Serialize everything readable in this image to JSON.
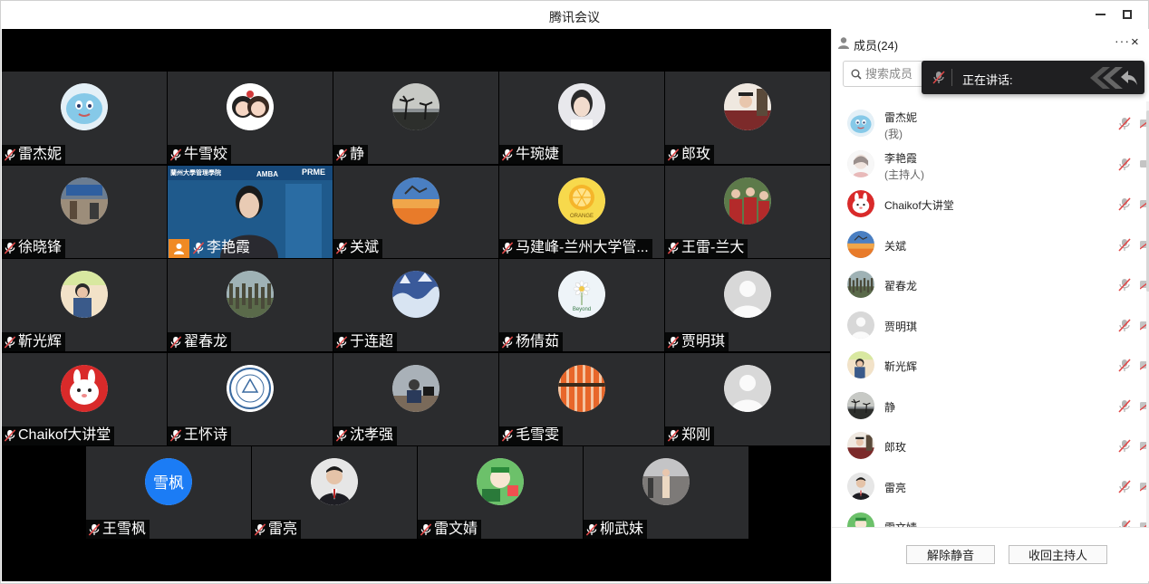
{
  "window": {
    "title": "腾讯会议"
  },
  "tiles": [
    {
      "name": "雷杰妮",
      "avatar": "squirtle",
      "col": 0,
      "row": 0
    },
    {
      "name": "牛雪姣",
      "avatar": "cartoon-couple",
      "col": 1,
      "row": 0
    },
    {
      "name": "静",
      "avatar": "palm-sunset",
      "col": 2,
      "row": 0
    },
    {
      "name": "牛琬婕",
      "avatar": "portrait",
      "col": 3,
      "row": 0
    },
    {
      "name": "郎玫",
      "avatar": "graduation",
      "col": 4,
      "row": 0
    },
    {
      "name": "徐晓锋",
      "avatar": "street",
      "col": 0,
      "row": 1
    },
    {
      "name": "李艳霞",
      "avatar": "video",
      "col": 1,
      "row": 1,
      "video": true,
      "video_text": [
        "蘭州大學管理學院",
        "AMBA",
        "PRME"
      ]
    },
    {
      "name": "关斌",
      "avatar": "sunset-sky",
      "col": 2,
      "row": 1
    },
    {
      "name": "马建峰-兰州大学管...",
      "avatar": "orange",
      "col": 3,
      "row": 1,
      "avatar_text": "ORANGE"
    },
    {
      "name": "王雷-兰大",
      "avatar": "graduation-red",
      "col": 4,
      "row": 1
    },
    {
      "name": "靳光辉",
      "avatar": "child",
      "col": 0,
      "row": 2
    },
    {
      "name": "翟春龙",
      "avatar": "forest",
      "col": 1,
      "row": 2
    },
    {
      "name": "于连超",
      "avatar": "snow",
      "col": 2,
      "row": 2
    },
    {
      "name": "杨倩茹",
      "avatar": "flower",
      "col": 3,
      "row": 2,
      "avatar_text": "Beyond"
    },
    {
      "name": "贾明琪",
      "avatar": "default",
      "col": 4,
      "row": 2
    },
    {
      "name": "Chaikof大讲堂",
      "avatar": "white-rabbit",
      "col": 0,
      "row": 3
    },
    {
      "name": "王怀诗",
      "avatar": "university-seal",
      "col": 1,
      "row": 3
    },
    {
      "name": "沈孝强",
      "avatar": "desk",
      "col": 2,
      "row": 3
    },
    {
      "name": "毛雪雯",
      "avatar": "orange-pattern",
      "col": 3,
      "row": 3
    },
    {
      "name": "郑刚",
      "avatar": "default",
      "col": 4,
      "row": 3
    },
    {
      "name": "王雪枫",
      "avatar": "initials",
      "avatar_text": "雪枫",
      "col": 0,
      "row": 4
    },
    {
      "name": "雷亮",
      "avatar": "suit",
      "col": 1,
      "row": 4
    },
    {
      "name": "雷文婧",
      "avatar": "green-cartoon",
      "col": 2,
      "row": 4
    },
    {
      "name": "柳武妹",
      "avatar": "standing",
      "col": 3,
      "row": 4
    }
  ],
  "sidebar": {
    "title": "成员(24)",
    "more": "···",
    "close": "×",
    "search_placeholder": "搜索成员",
    "speaking_label": "正在讲话:",
    "members": [
      {
        "name": "雷杰妮",
        "sub": "(我)",
        "avatar": "squirtle"
      },
      {
        "name": "李艳霞",
        "sub": "(主持人)",
        "avatar": "sketch-girl"
      },
      {
        "name": "Chaikof大讲堂",
        "sub": "",
        "avatar": "white-rabbit"
      },
      {
        "name": "关斌",
        "sub": "",
        "avatar": "sunset-sky"
      },
      {
        "name": "翟春龙",
        "sub": "",
        "avatar": "forest"
      },
      {
        "name": "贾明琪",
        "sub": "",
        "avatar": "default"
      },
      {
        "name": "靳光辉",
        "sub": "",
        "avatar": "child"
      },
      {
        "name": "静",
        "sub": "",
        "avatar": "palm-sunset"
      },
      {
        "name": "郎玫",
        "sub": "",
        "avatar": "graduation"
      },
      {
        "name": "雷亮",
        "sub": "",
        "avatar": "suit"
      },
      {
        "name": "雷文婧",
        "sub": "",
        "avatar": "green-cartoon"
      }
    ],
    "unmute_button": "解除静音",
    "reclaim_host_button": "收回主持人"
  },
  "colors": {
    "tile_bg": "#2b2c2e",
    "video_bg": "#1d4d78",
    "host_badge": "#f08a24",
    "muted_red": "#e04848",
    "speaking_bg": "#1f1f21"
  }
}
